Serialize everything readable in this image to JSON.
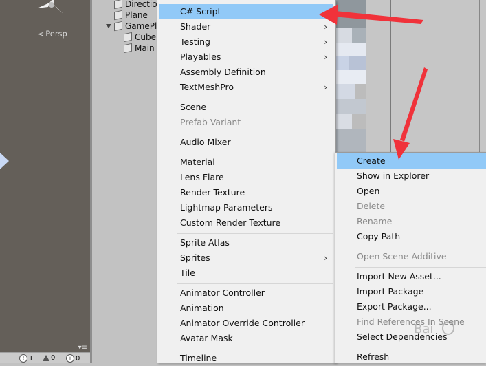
{
  "scene": {
    "persp_label": "Persp",
    "status": {
      "errors": "1",
      "warnings": "0",
      "messages": "0",
      "more_label": "▾≡"
    }
  },
  "hierarchy": {
    "items": [
      {
        "label": "Directio"
      },
      {
        "label": "Plane"
      },
      {
        "label": "GamePl"
      },
      {
        "label": "Cube"
      },
      {
        "label": "Main"
      }
    ]
  },
  "menu": {
    "items": [
      {
        "label": "C# Script",
        "highlighted": true
      },
      {
        "label": "Shader",
        "submenu": true
      },
      {
        "label": "Testing",
        "submenu": true
      },
      {
        "label": "Playables",
        "submenu": true
      },
      {
        "label": "Assembly Definition"
      },
      {
        "label": "TextMeshPro",
        "submenu": true
      },
      {
        "label": "Scene"
      },
      {
        "label": "Prefab Variant",
        "disabled": true
      },
      {
        "label": "Audio Mixer"
      },
      {
        "label": "Material"
      },
      {
        "label": "Lens Flare"
      },
      {
        "label": "Render Texture"
      },
      {
        "label": "Lightmap Parameters"
      },
      {
        "label": "Custom Render Texture"
      },
      {
        "label": "Sprite Atlas"
      },
      {
        "label": "Sprites",
        "submenu": true
      },
      {
        "label": "Tile"
      },
      {
        "label": "Animator Controller"
      },
      {
        "label": "Animation"
      },
      {
        "label": "Animator Override Controller"
      },
      {
        "label": "Avatar Mask"
      },
      {
        "label": "Timeline"
      }
    ],
    "arrow_glyph": "›"
  },
  "submenu": {
    "items": [
      {
        "label": "Create",
        "highlighted": true
      },
      {
        "label": "Show in Explorer"
      },
      {
        "label": "Open"
      },
      {
        "label": "Delete",
        "disabled": true
      },
      {
        "label": "Rename",
        "disabled": true
      },
      {
        "label": "Copy Path"
      },
      {
        "label": "Open Scene Additive",
        "disabled": true
      },
      {
        "label": "Import New Asset..."
      },
      {
        "label": "Import Package"
      },
      {
        "label": "Export Package..."
      },
      {
        "label": "Find References In Scene",
        "disabled": true
      },
      {
        "label": "Select Dependencies"
      },
      {
        "label": "Refresh"
      }
    ]
  },
  "colors": {
    "highlight": "#91c9f7",
    "annotation_arrow": "#f0323a",
    "menu_bg": "#f0f0f0",
    "scene_bg": "#645f59"
  }
}
